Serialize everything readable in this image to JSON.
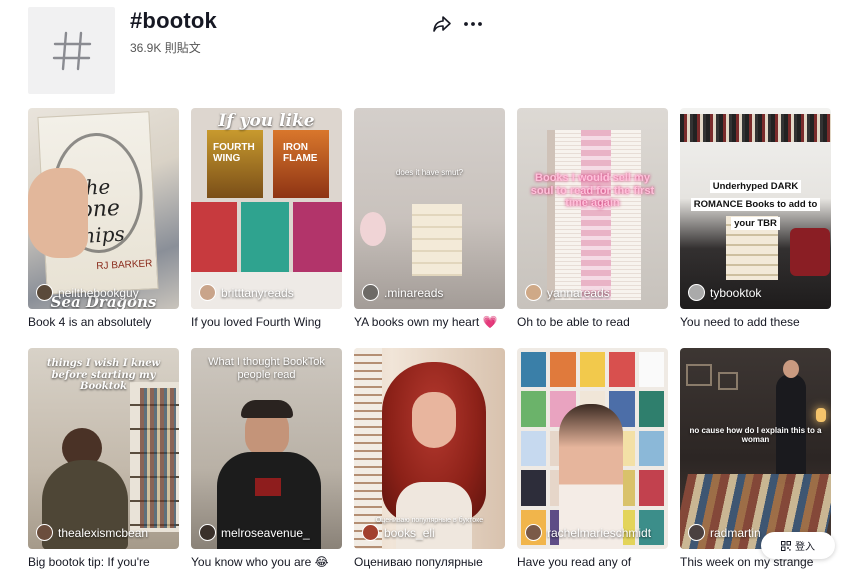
{
  "header": {
    "title": "#bootok",
    "post_count": "36.9K 則貼文",
    "hash_icon": "hashtag-icon",
    "share_icon": "share-arrow-icon",
    "more_icon": "more-dots-icon"
  },
  "videos": [
    {
      "author": "neilthebookguy",
      "caption": "Book 4 is an absolutely",
      "overlay": "",
      "overlay_bottom": "Sea Dragons"
    },
    {
      "author": "britttanyreads",
      "caption": "If you loved Fourth Wing",
      "overlay": "If you like",
      "overlay_bottom": ""
    },
    {
      "author": ".minareads",
      "caption": "YA books own my heart 💗",
      "overlay": "does it have smut?",
      "overlay_bottom": ""
    },
    {
      "author": "yannareads",
      "caption": "Oh to be able to read",
      "overlay": "Books I would sell my soul to read for the first time again",
      "overlay_bottom": ""
    },
    {
      "author": "tybooktok",
      "caption": "You need to add these",
      "overlay": "Underhyped DARK ROMANCE Books to add to your TBR",
      "overlay_bottom": ""
    },
    {
      "author": "thealexismcbean",
      "caption": "Big bootok tip: If you're",
      "overlay": "things I wish I knew before starting my Booktok",
      "overlay_bottom": ""
    },
    {
      "author": "melroseavenue_",
      "caption": "You know who you are 😂",
      "overlay": "What I thought BookTok people read",
      "overlay_bottom": ""
    },
    {
      "author": "books_eli",
      "caption": "Оцениваю популярные",
      "overlay": "",
      "overlay_bottom": "Оцениваю популярные в буктоке"
    },
    {
      "author": "rachelmarieschmidt",
      "caption": "Have you read any of",
      "overlay": "",
      "overlay_bottom": ""
    },
    {
      "author": "radmartin",
      "caption": "This week on my strange",
      "overlay": "no cause how do I explain this to a woman",
      "overlay_bottom": ""
    }
  ],
  "login": {
    "label": "登入",
    "icon": "qr-code-icon"
  },
  "colors": {
    "text": "#161823",
    "muted": "#555555",
    "placeholder_bg": "#f1f1f2"
  }
}
